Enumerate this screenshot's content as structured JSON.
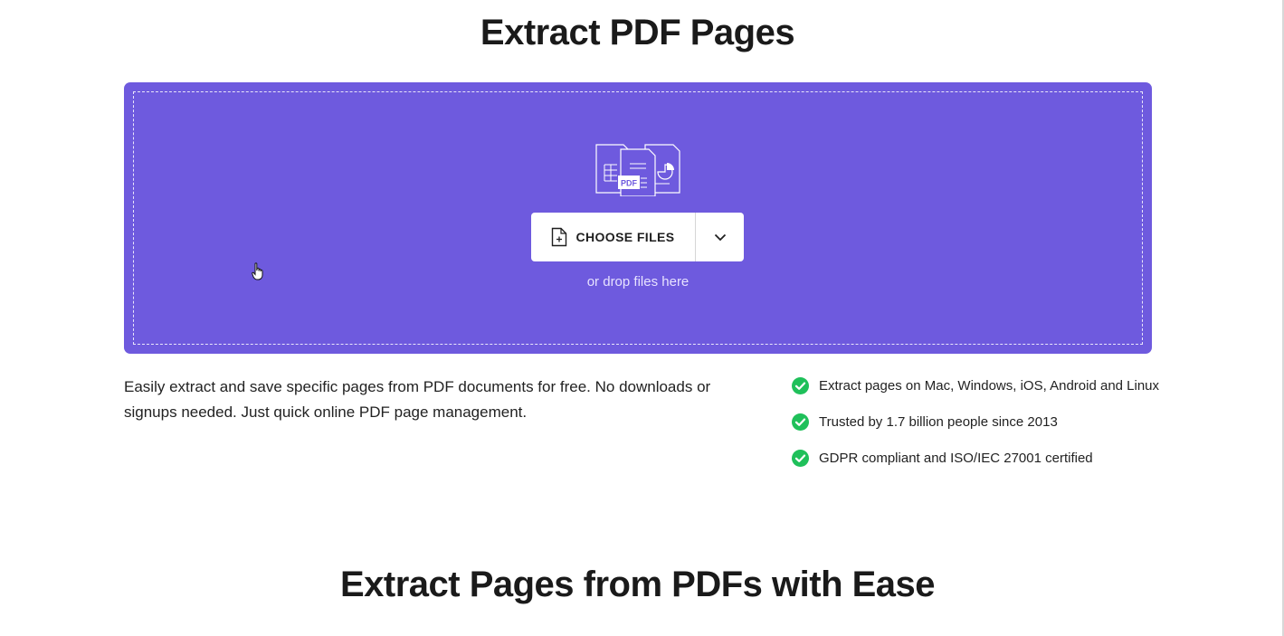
{
  "page": {
    "title": "Extract PDF Pages"
  },
  "upload": {
    "choose_label": "CHOOSE FILES",
    "drop_hint": "or drop files here",
    "accent_color": "#6e5ade",
    "illustration_badge": "PDF"
  },
  "intro": {
    "description": "Easily extract and save specific pages from PDF documents for free. No downloads or signups needed. Just quick online PDF page management."
  },
  "features": [
    {
      "label": "Extract pages on Mac, Windows, iOS, Android and Linux",
      "icon": "check-circle-icon"
    },
    {
      "label": "Trusted by 1.7 billion people since 2013",
      "icon": "check-circle-icon"
    },
    {
      "label": "GDPR compliant and ISO/IEC 27001 certified",
      "icon": "check-circle-icon"
    }
  ],
  "section": {
    "title": "Extract Pages from PDFs with Ease"
  },
  "colors": {
    "check": "#1fc05a"
  }
}
